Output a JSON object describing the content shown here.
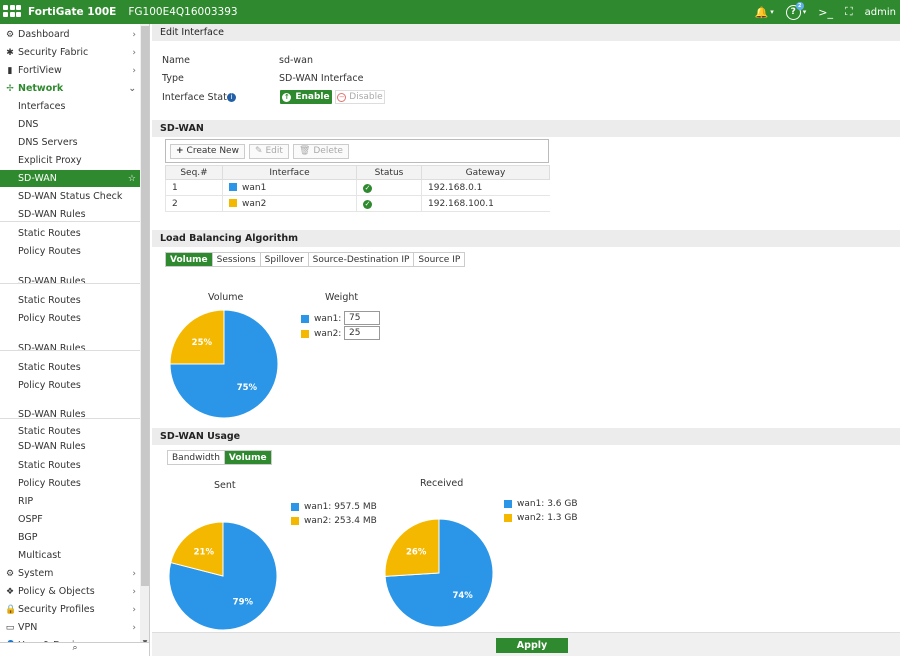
{
  "topbar": {
    "brand": "FortiGate 100E",
    "serial": "FG100E4Q16003393",
    "user": "admin",
    "help_badge": "2",
    "cli_icon": ">_"
  },
  "sidebar": {
    "items": [
      {
        "label": "Dashboard",
        "icon": "dashboard-icon",
        "glyph": "⚙"
      },
      {
        "label": "Security Fabric",
        "icon": "fabric-icon",
        "glyph": "✱"
      },
      {
        "label": "FortiView",
        "icon": "fortiview-icon",
        "glyph": "▮"
      },
      {
        "label": "Network",
        "icon": "network-icon",
        "glyph": "✢"
      },
      {
        "label": "Interfaces"
      },
      {
        "label": "DNS"
      },
      {
        "label": "DNS Servers"
      },
      {
        "label": "Explicit Proxy"
      },
      {
        "label": "SD-WAN"
      },
      {
        "label": "SD-WAN Status Check"
      },
      {
        "label": "SD-WAN Rules"
      },
      {
        "label": "Static Routes"
      },
      {
        "label": "Policy Routes"
      },
      {
        "label": "SD-WAN Rules"
      },
      {
        "label": "Static Routes"
      },
      {
        "label": "Policy Routes"
      },
      {
        "label": "SD-WAN Rules"
      },
      {
        "label": "Static Routes"
      },
      {
        "label": "Policy Routes"
      },
      {
        "label": "SD-WAN Rules"
      },
      {
        "label": "Static Routes"
      },
      {
        "label": "SD-WAN Rules"
      },
      {
        "label": "Static Routes"
      },
      {
        "label": "Policy Routes"
      },
      {
        "label": "RIP"
      },
      {
        "label": "OSPF"
      },
      {
        "label": "BGP"
      },
      {
        "label": "Multicast"
      },
      {
        "label": "System",
        "icon": "system-icon",
        "glyph": "⚙"
      },
      {
        "label": "Policy & Objects",
        "icon": "policy-icon",
        "glyph": "❖"
      },
      {
        "label": "Security Profiles",
        "icon": "lock-icon",
        "glyph": "🔒"
      },
      {
        "label": "VPN",
        "icon": "vpn-icon",
        "glyph": "▭"
      },
      {
        "label": "User & Device",
        "icon": "user-icon",
        "glyph": "👤"
      }
    ]
  },
  "header": {
    "title": "Edit Interface"
  },
  "form": {
    "name_label": "Name",
    "name_value": "sd-wan",
    "type_label": "Type",
    "type_value": "SD-WAN Interface",
    "state_label": "Interface State",
    "enable": "Enable",
    "disable": "Disable"
  },
  "sdwan": {
    "title": "SD-WAN",
    "toolbar": {
      "create": "Create New",
      "edit": "Edit",
      "delete": "Delete"
    },
    "columns": [
      "Seq.#",
      "Interface",
      "Status",
      "Gateway"
    ],
    "rows": [
      {
        "seq": "1",
        "iface": "wan1",
        "color": "#2b96e8",
        "gateway": "192.168.0.1"
      },
      {
        "seq": "2",
        "iface": "wan2",
        "color": "#f5b800",
        "gateway": "192.168.100.1"
      }
    ]
  },
  "lb": {
    "title": "Load Balancing Algorithm",
    "tabs": [
      "Volume",
      "Sessions",
      "Spillover",
      "Source-Destination IP",
      "Source IP"
    ],
    "pie_title": "Volume",
    "weight_title": "Weight",
    "weights": [
      {
        "label": "wan1:",
        "value": "75",
        "color": "#2b96e8"
      },
      {
        "label": "wan2:",
        "value": "25",
        "color": "#f5b800"
      }
    ]
  },
  "usage": {
    "title": "SD-WAN Usage",
    "tabs": [
      "Bandwidth",
      "Volume"
    ],
    "sent_title": "Sent",
    "sent_legend": [
      "wan1: 957.5 MB",
      "wan2: 253.4 MB"
    ],
    "received_title": "Received",
    "received_legend": [
      "wan1: 3.6 GB",
      "wan2: 1.3 GB"
    ]
  },
  "footer": {
    "apply": "Apply"
  },
  "colors": {
    "brand": "#2f8a2f",
    "wan1": "#2b96e8",
    "wan2": "#f5b800"
  },
  "chart_data": [
    {
      "type": "pie",
      "title": "Volume",
      "categories": [
        "wan1",
        "wan2"
      ],
      "values": [
        75,
        25
      ],
      "labels": [
        "75%",
        "25%"
      ]
    },
    {
      "type": "pie",
      "title": "Sent",
      "categories": [
        "wan1",
        "wan2"
      ],
      "values": [
        79,
        21
      ],
      "labels": [
        "79%",
        "21%"
      ]
    },
    {
      "type": "pie",
      "title": "Received",
      "categories": [
        "wan1",
        "wan2"
      ],
      "values": [
        74,
        26
      ],
      "labels": [
        "74%",
        "26%"
      ]
    }
  ]
}
